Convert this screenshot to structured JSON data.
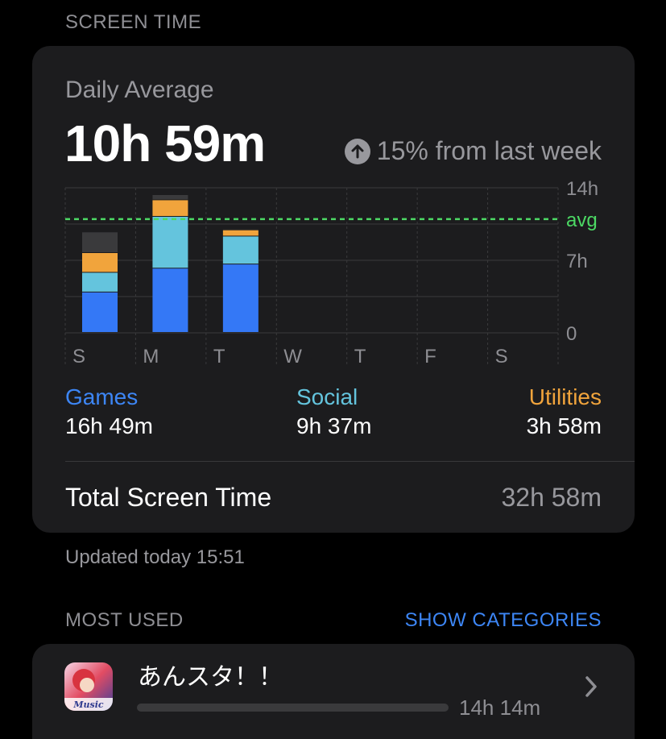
{
  "screen_time_header": "SCREEN TIME",
  "daily": {
    "label": "Daily Average",
    "value": "10h 59m",
    "change": "15% from last week",
    "change_icon": "arrow-up-circle-icon"
  },
  "chart_data": {
    "type": "bar",
    "stacked": true,
    "categories": [
      "S",
      "M",
      "T",
      "W",
      "T",
      "F",
      "S"
    ],
    "y_ticks": [
      "14h",
      "7h",
      "0"
    ],
    "ylim": [
      0,
      14
    ],
    "avg_label": "avg",
    "avg_value": 10.98,
    "series": [
      {
        "key": "games",
        "color": "#3478f6",
        "values": [
          3.9,
          6.2,
          6.6,
          0,
          0,
          0,
          0
        ]
      },
      {
        "key": "social",
        "color": "#64c4dd",
        "values": [
          1.9,
          5.0,
          2.7,
          0,
          0,
          0,
          0
        ]
      },
      {
        "key": "utilities",
        "color": "#f1a43c",
        "values": [
          1.9,
          1.6,
          0.6,
          0,
          0,
          0,
          0
        ]
      },
      {
        "key": "other",
        "color": "#3a3a3c",
        "values": [
          2.0,
          0.5,
          0.1,
          0,
          0,
          0,
          0
        ]
      }
    ],
    "colors": {
      "grid": "#3a3a3c",
      "avg_line": "#4cd964",
      "tick_text": "#8e8e93"
    }
  },
  "categories": [
    {
      "name": "Games",
      "value": "16h 49m",
      "color": "#3d86f5"
    },
    {
      "name": "Social",
      "value": "9h 37m",
      "color": "#64c4dd"
    },
    {
      "name": "Utilities",
      "value": "3h 58m",
      "color": "#f1a43c"
    }
  ],
  "total": {
    "label": "Total Screen Time",
    "value": "32h 58m"
  },
  "updated": "Updated today 15:51",
  "most_used": {
    "header": "MOST USED",
    "action": "SHOW CATEGORIES",
    "apps": [
      {
        "name": "あんスタ！！",
        "time": "14h 14m",
        "usage_fraction": 1.0,
        "icon": "ensemble-stars-app-icon"
      }
    ]
  }
}
